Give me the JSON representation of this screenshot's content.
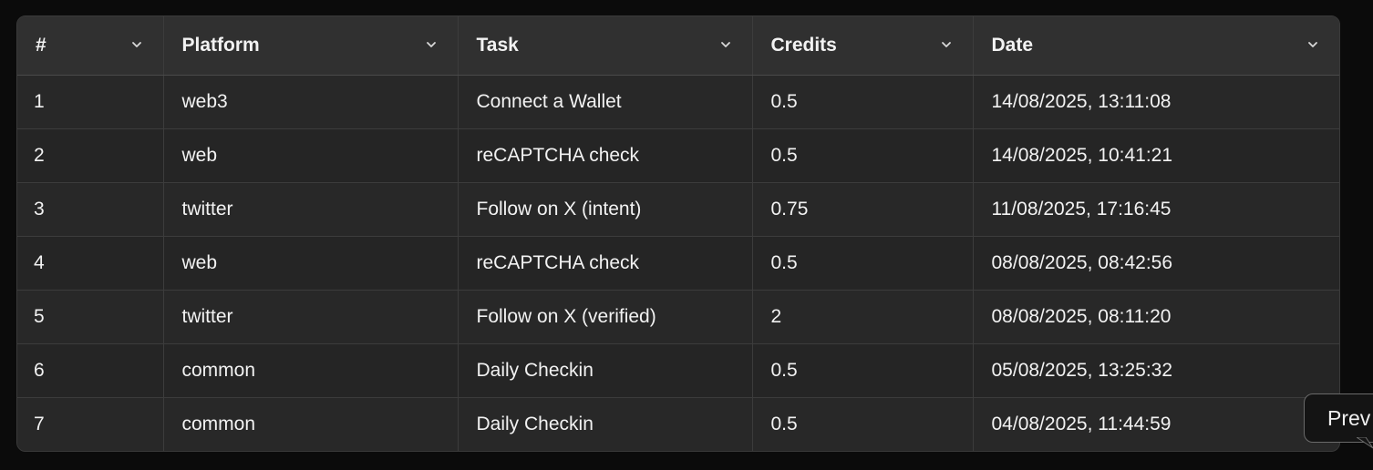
{
  "table": {
    "columns": [
      {
        "label": "#"
      },
      {
        "label": "Platform"
      },
      {
        "label": "Task"
      },
      {
        "label": "Credits"
      },
      {
        "label": "Date"
      }
    ],
    "rows": [
      {
        "num": "1",
        "platform": "web3",
        "task": "Connect a Wallet",
        "credits": "0.5",
        "date": "14/08/2025, 13:11:08"
      },
      {
        "num": "2",
        "platform": "web",
        "task": "reCAPTCHA check",
        "credits": "0.5",
        "date": "14/08/2025, 10:41:21"
      },
      {
        "num": "3",
        "platform": "twitter",
        "task": "Follow on X (intent)",
        "credits": "0.75",
        "date": "11/08/2025, 17:16:45"
      },
      {
        "num": "4",
        "platform": "web",
        "task": "reCAPTCHA check",
        "credits": "0.5",
        "date": "08/08/2025, 08:42:56"
      },
      {
        "num": "5",
        "platform": "twitter",
        "task": "Follow on X (verified)",
        "credits": "2",
        "date": "08/08/2025, 08:11:20"
      },
      {
        "num": "6",
        "platform": "common",
        "task": "Daily Checkin",
        "credits": "0.5",
        "date": "05/08/2025, 13:25:32"
      },
      {
        "num": "7",
        "platform": "common",
        "task": "Daily Checkin",
        "credits": "0.5",
        "date": "04/08/2025, 11:44:59"
      }
    ]
  },
  "tooltip": {
    "text": "Prev"
  },
  "icons": {
    "sort": "chevron-down-icon"
  },
  "colors": {
    "background": "#0b0b0b",
    "table_bg": "#262626",
    "header_bg": "#303030",
    "text": "#f2f2f2",
    "border": "#3c3c3c"
  }
}
